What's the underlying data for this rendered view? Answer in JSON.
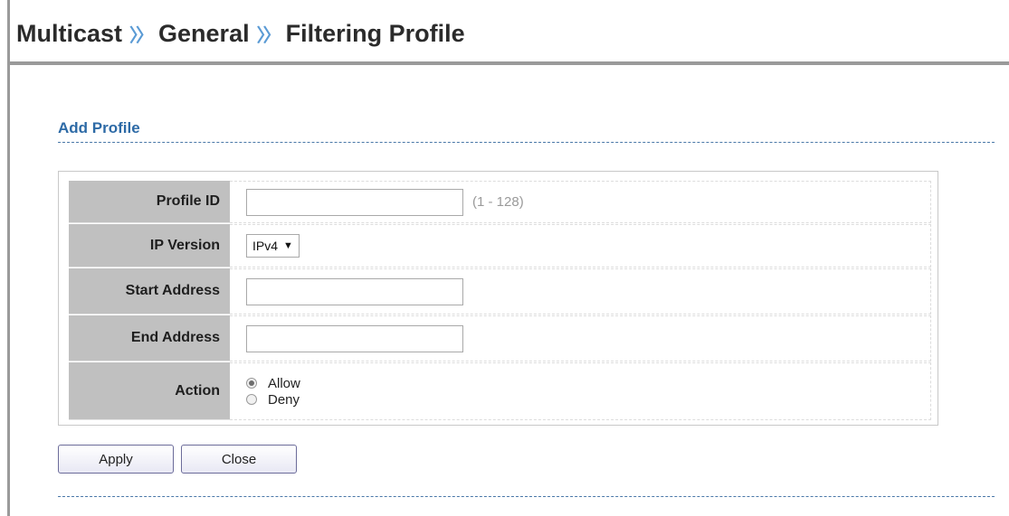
{
  "breadcrumb": {
    "items": [
      "Multicast",
      "General",
      "Filtering Profile"
    ],
    "separator": "〉〉"
  },
  "section": {
    "title": "Add Profile"
  },
  "form": {
    "profile_id": {
      "label": "Profile ID",
      "value": "",
      "hint": "(1 - 128)"
    },
    "ip_version": {
      "label": "IP Version",
      "selected": "IPv4",
      "arrow": "▼"
    },
    "start_address": {
      "label": "Start Address",
      "value": ""
    },
    "end_address": {
      "label": "End Address",
      "value": ""
    },
    "action": {
      "label": "Action",
      "options": [
        "Allow",
        "Deny"
      ],
      "selected": "Allow"
    }
  },
  "buttons": {
    "apply": "Apply",
    "close": "Close"
  },
  "colors": {
    "accent_title": "#2d6aa6",
    "label_bg": "#c0c0c0",
    "separator_blue": "#5b9bd5"
  }
}
